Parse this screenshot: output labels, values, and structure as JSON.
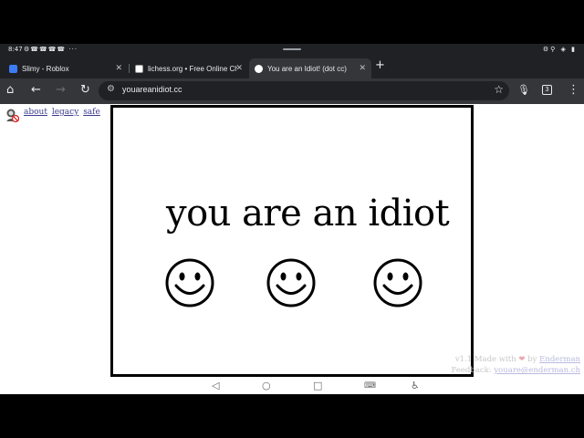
{
  "status_bar": {
    "time": "8:47",
    "notification_icons": "⚙☎☎☎☎ ···",
    "system_icons": "⚙⚲ ◈ ▮"
  },
  "tabs": [
    {
      "title": "Slimy - Roblox",
      "favicon": "roblox-icon",
      "color": "#3d7cf4",
      "active": false
    },
    {
      "title": "lichess.org • Free Online Ch",
      "favicon": "lichess-icon",
      "color": "#ffffff",
      "active": false
    },
    {
      "title": "You are an Idiot! (dot cc)",
      "favicon": "smiley-icon",
      "color": "#ffffff",
      "active": true
    }
  ],
  "toolbar": {
    "url": "youareanidiot.cc",
    "tab_count": "3"
  },
  "page": {
    "top_links": [
      "about",
      "legacy",
      "safe"
    ],
    "headline": "you are an idiot",
    "smiley_count": 3,
    "credits": {
      "version": "v1.1",
      "made_with": "Made with",
      "by": "by",
      "author": "Enderman",
      "feedback_label": "Feedback:",
      "feedback_email": "youare@enderman.ch"
    }
  },
  "colors": {
    "browser_dark": "#202124",
    "toolbar": "#35363a",
    "page_bg": "#ffffff",
    "heart": "#e8a7b0"
  }
}
